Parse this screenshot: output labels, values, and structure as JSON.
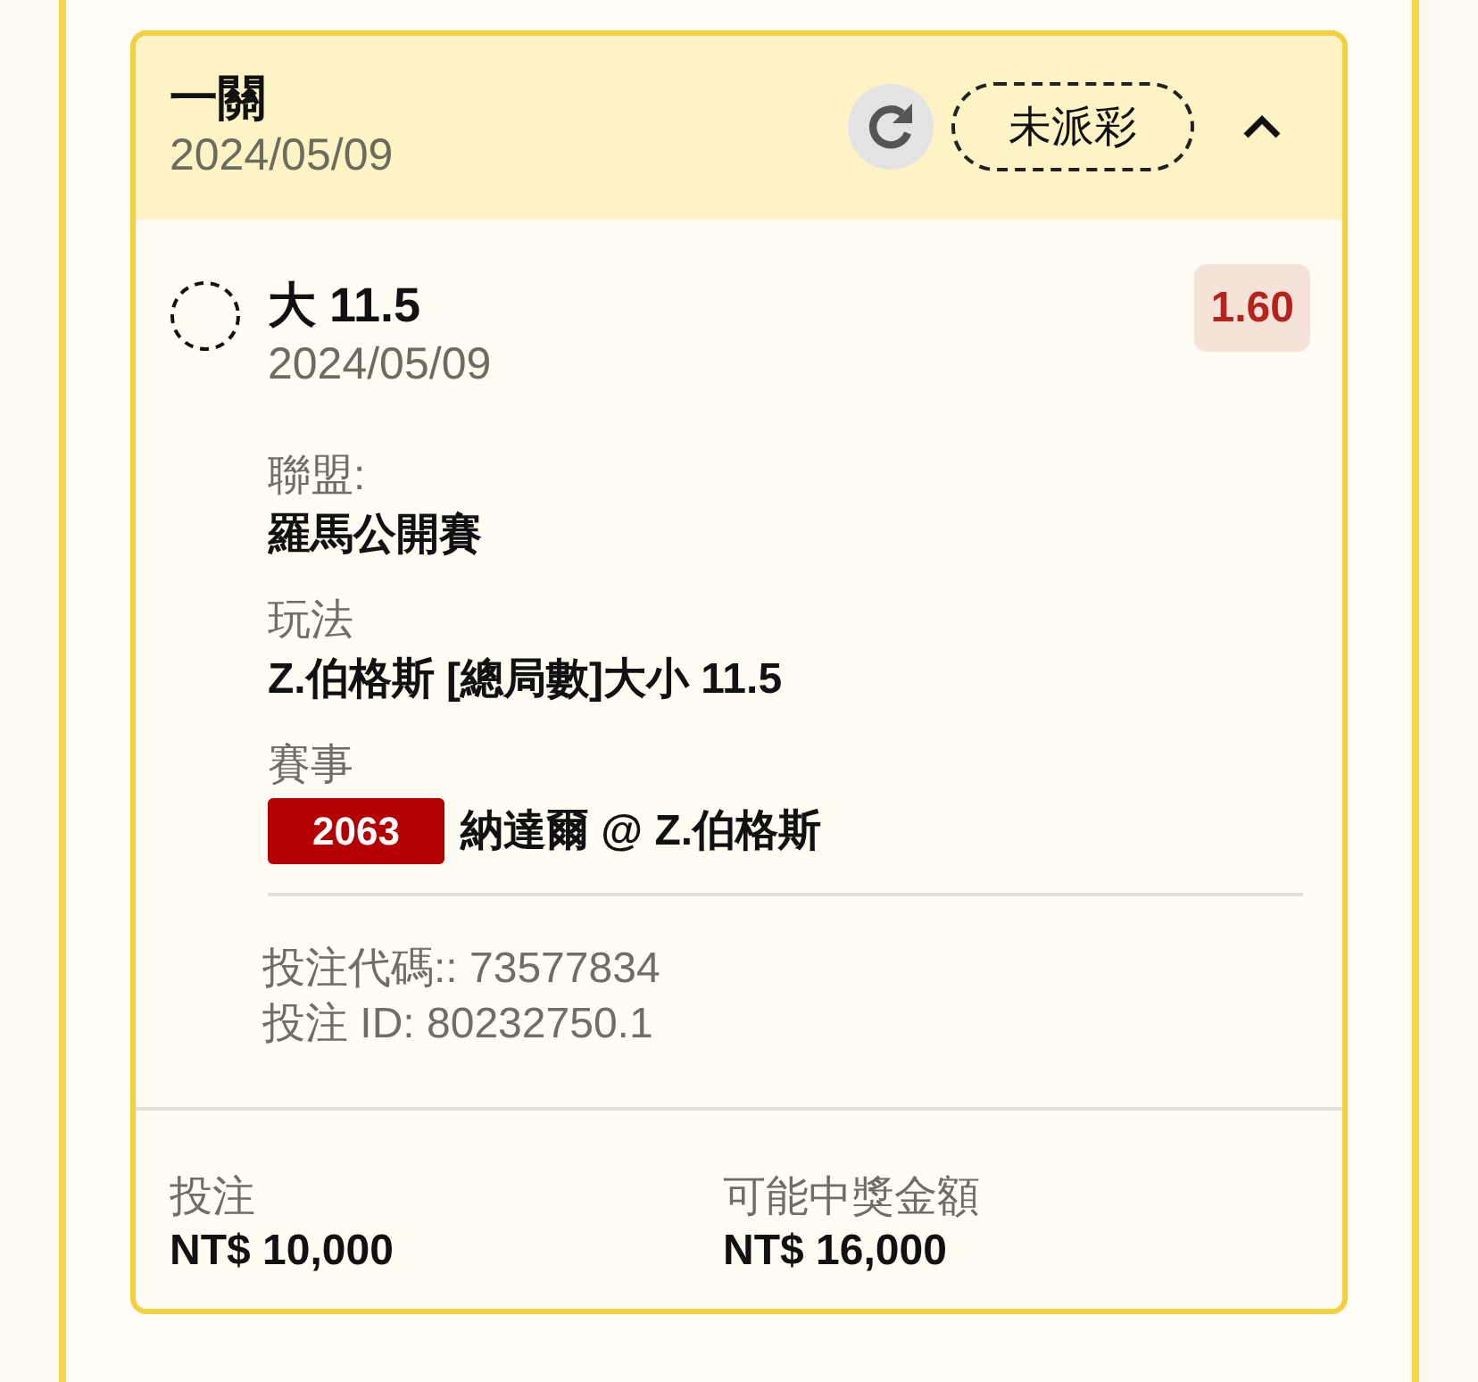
{
  "bet": {
    "title": "一關",
    "date": "2024/05/09",
    "status": "未派彩",
    "expanded": true
  },
  "selection": {
    "name": "大 11.5",
    "date": "2024/05/09",
    "odds": "1.60"
  },
  "details": [
    {
      "label": "聯盟:",
      "value": "羅馬公開賽"
    },
    {
      "label": "玩法",
      "value": "Z.伯格斯 [總局數]大小 11.5"
    },
    {
      "label": "賽事",
      "badge": "2063",
      "value": "納達爾 @ Z.伯格斯"
    }
  ],
  "references": [
    "投注代碼:: 73577834",
    "投注 ID: 80232750.1"
  ],
  "totals": [
    {
      "label": "投注",
      "amount": "NT$ 10,000"
    },
    {
      "label": "可能中獎金額",
      "amount": "NT$ 16,000"
    }
  ]
}
